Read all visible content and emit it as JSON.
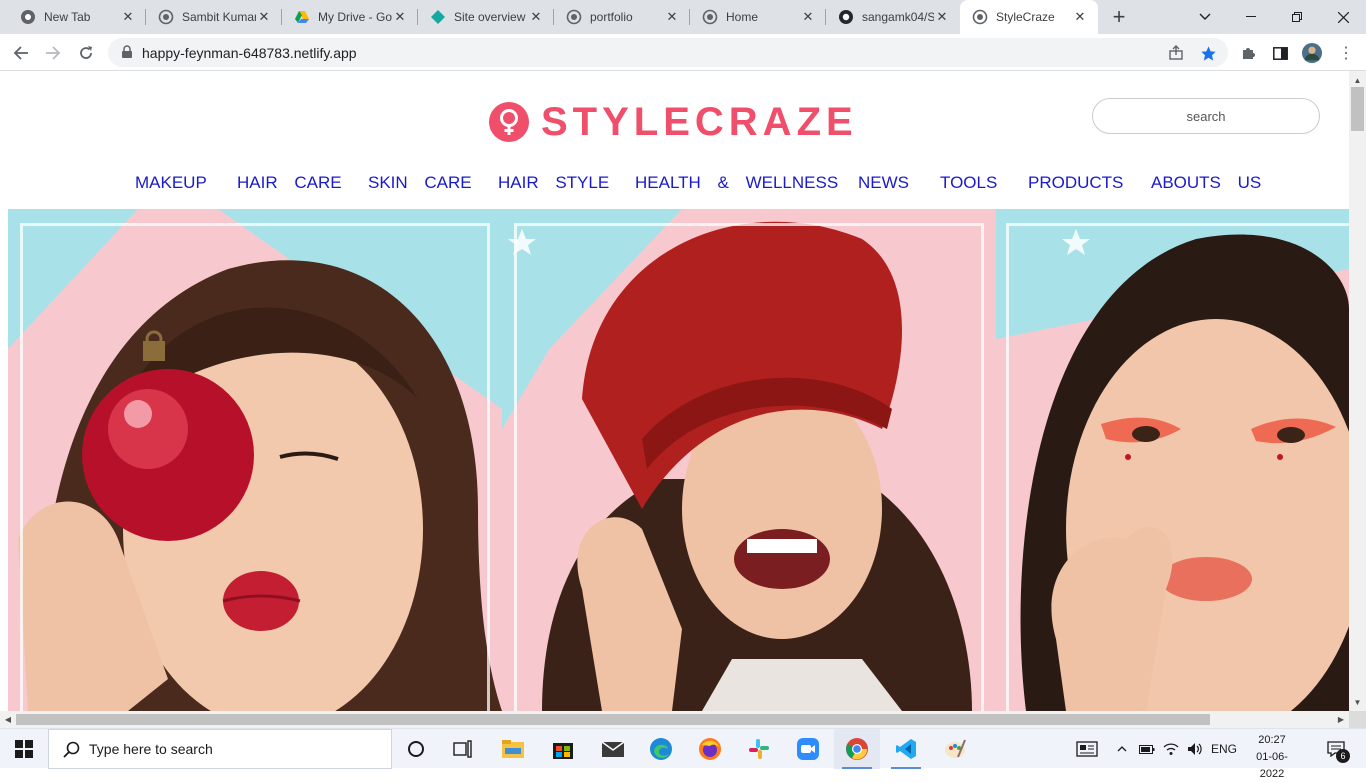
{
  "browser": {
    "tabs": [
      {
        "title": "New Tab",
        "icon": "chrome-icon"
      },
      {
        "title": "Sambit Kumar",
        "icon": "globe-icon"
      },
      {
        "title": "My Drive - Google Drive",
        "icon": "google-drive-icon"
      },
      {
        "title": "Site overview",
        "icon": "netlify-icon"
      },
      {
        "title": "portfolio",
        "icon": "globe-icon"
      },
      {
        "title": "Home",
        "icon": "globe-icon"
      },
      {
        "title": "sangamk04/S",
        "icon": "github-icon"
      },
      {
        "title": "StyleCraze",
        "icon": "globe-icon",
        "active": true
      }
    ],
    "url": "happy-feynman-648783.netlify.app"
  },
  "site": {
    "brand": "STYLECRAZE",
    "brand_color": "#ef4f6b",
    "search_placeholder": "search",
    "nav": [
      "MAKEUP",
      "HAIR CARE",
      "SKIN CARE",
      "HAIR STYLE",
      "HEALTH & WELLNESS",
      "NEWS",
      "TOOLS",
      "PRODUCTS",
      "ABOUTS US"
    ],
    "nav_color": "#1a1acc",
    "hero_colors": {
      "sky": "#a9e1e8",
      "pink": "#f7c9cf"
    }
  },
  "taskbar": {
    "search_placeholder": "Type here to search",
    "language": "ENG",
    "time": "20:27",
    "date": "01-06-2022",
    "notification_count": "6"
  }
}
